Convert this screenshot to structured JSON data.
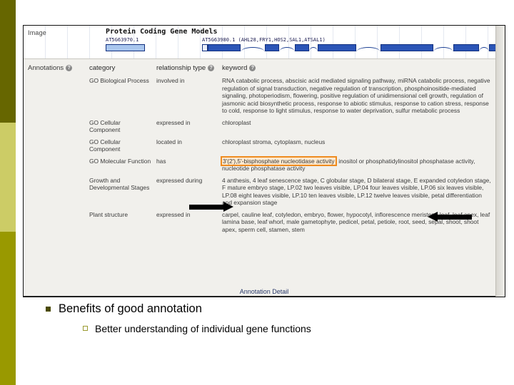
{
  "slide": {
    "bullets": [
      {
        "level": 1,
        "marker": "square-filled-marker",
        "text": "Benefits of good annotation"
      },
      {
        "level": 2,
        "marker": "square-outline-marker",
        "text": "Better understanding of individual gene functions"
      }
    ]
  },
  "screenshot": {
    "image_section": {
      "label": "Image",
      "track_title": "Protein Coding Gene Models",
      "gene_left_id": "AT5G63970.1",
      "gene_right_id": "AT5G63980.1 (AHL28,FRY1,HOS2,SAL1,ATSAL1)"
    },
    "annotations": {
      "section_label": "Annotations",
      "help_glyph": "?",
      "columns": {
        "category": "category",
        "relationship": "relationship type",
        "keyword": "keyword"
      },
      "rows": [
        {
          "category": "GO Biological Process",
          "relationship": "involved in",
          "keyword": "RNA catabolic process, abscisic acid mediated signaling pathway, miRNA catabolic process, negative regulation of signal transduction, negative regulation of transcription, phosphoinositide-mediated signaling, photoperiodism, flowering, positive regulation of unidimensional cell growth, regulation of jasmonic acid biosynthetic process, response to abiotic stimulus, response to cation stress, response to cold, response to light stimulus, response to water deprivation, sulfur metabolic process"
        },
        {
          "category": "GO Cellular Component",
          "relationship": "expressed in",
          "keyword": "chloroplast"
        },
        {
          "category": "GO Cellular Component",
          "relationship": "located in",
          "keyword": "chloroplast stroma, cytoplasm, nucleus"
        },
        {
          "category": "GO Molecular Function",
          "relationship": "has",
          "keyword_highlighted": "3'(2'),5'-bisphosphate nucleotidase activity",
          "keyword_rest": ", inositol or phosphatidylinositol phosphatase activity, nucleotide phosphatase activity",
          "highlighted": true
        },
        {
          "category": "Growth and Developmental Stages",
          "relationship": "expressed during",
          "keyword": "4 anthesis, 4 leaf senescence stage, C globular stage, D bilateral stage, E expanded cotyledon stage, F mature embryo stage, LP.02 two leaves visible, LP.04 four leaves visible, LP.06 six leaves visible, LP.08 eight leaves visible, LP.10 ten leaves visible, LP.12 twelve leaves visible, petal differentiation and expansion stage"
        },
        {
          "category": "Plant structure",
          "relationship": "expressed in",
          "keyword": "carpel, cauline leaf, cotyledon, embryo, flower, hypocotyl, inflorescence meristem, leaf, leaf apex, leaf lamina base, leaf whorl, male gametophyte, pedicel, petal, petiole, root, seed, sepal, shoot, shoot apex, sperm cell, stamen, stem"
        }
      ],
      "footer_link": "Annotation Detail"
    }
  },
  "colors": {
    "band_top": "#666600",
    "band_mid": "#cccc66",
    "band_bottom": "#999900",
    "keyword_link": "#3b5ea8",
    "highlight_border": "#ef8b1f",
    "exon_fill": "#2b55b7"
  }
}
